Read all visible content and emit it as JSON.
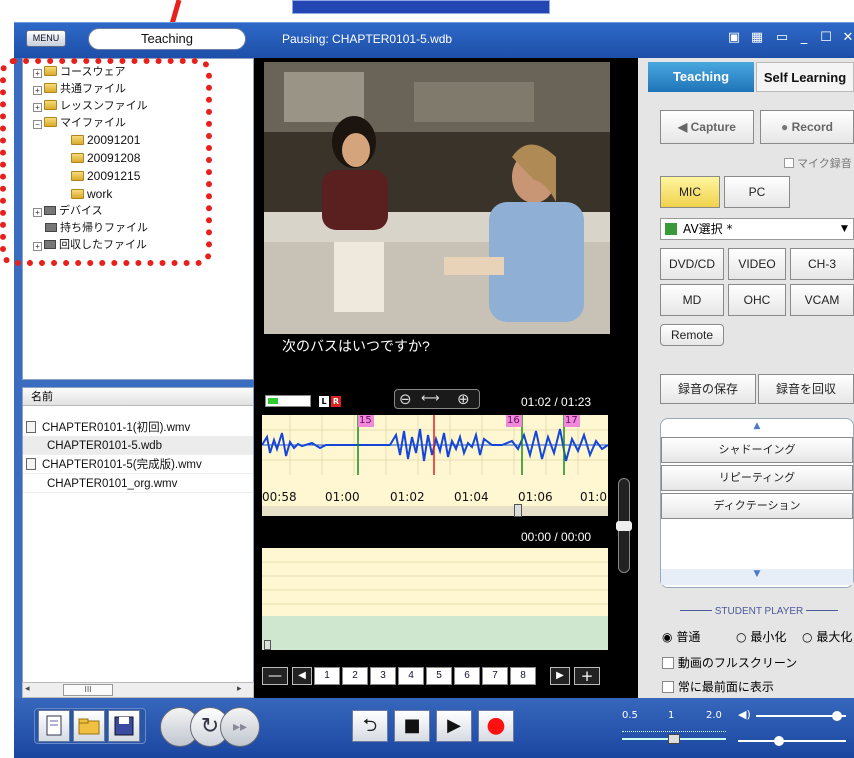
{
  "window": {
    "menu_label": "MENU",
    "mode_label": "Teaching",
    "title": "Pausing: CHAPTER0101-5.wdb"
  },
  "tree": {
    "items": [
      {
        "label": "コースウェア",
        "expander": "+"
      },
      {
        "label": "共通ファイル",
        "expander": "+"
      },
      {
        "label": "レッスンファイル",
        "expander": "+"
      },
      {
        "label": "マイファイル",
        "expander": "−"
      },
      {
        "label": "20091201"
      },
      {
        "label": "20091208"
      },
      {
        "label": "20091215"
      },
      {
        "label": "work"
      },
      {
        "label": "デバイス",
        "expander": "+"
      },
      {
        "label": "持ち帰りファイル"
      },
      {
        "label": "回収したファイル",
        "expander": "+"
      }
    ]
  },
  "filelist": {
    "header": "名前",
    "rows": [
      {
        "name": "CHAPTER0101-1(初回).wmv",
        "icon": "doc-icon"
      },
      {
        "name": "CHAPTER0101-5.wdb",
        "icon": ""
      },
      {
        "name": "CHAPTER0101-5(完成版).wmv",
        "icon": "doc-icon"
      },
      {
        "name": "CHAPTER0101_org.wmv",
        "icon": ""
      }
    ],
    "scroll_label": "III"
  },
  "player": {
    "subtitle": "次のバスはいつですか?",
    "time_main": "01:02 / 01:23",
    "time_rec": "00:00 / 00:00",
    "lr_l": "L",
    "lr_r": "R",
    "markers": [
      "15",
      "16",
      "17"
    ],
    "ticks": [
      "00:58",
      "01:00",
      "01:02",
      "01:04",
      "01:06",
      "01:0"
    ],
    "pages": [
      "1",
      "2",
      "3",
      "4",
      "5",
      "6",
      "7",
      "8"
    ]
  },
  "right": {
    "tab_teaching": "Teaching",
    "tab_self": "Self Learning",
    "capture": "Capture",
    "record": "Record",
    "mic_rec": "マイク録音",
    "mic": "MIC",
    "pc": "PC",
    "av_select": "AV選択 *",
    "sources_row1": [
      "DVD/CD",
      "VIDEO",
      "CH-3"
    ],
    "sources_row2": [
      "MD",
      "OHC",
      "VCAM"
    ],
    "remote": "Remote",
    "save_rec": "録音の保存",
    "collect_rec": "録音を回収",
    "modes": [
      "シャドーイング",
      "リピーティング",
      "ディクテーション"
    ],
    "student_player": "STUDENT PLAYER",
    "radio": [
      "普通",
      "最小化",
      "最大化"
    ],
    "checks": [
      "動画のフルスクリーン",
      "常に最前面に表示"
    ]
  },
  "bottom": {
    "speed_labels": [
      "0.5",
      "1",
      "2.0"
    ]
  },
  "colors": {
    "title_blue": "#1d4fa8",
    "annotation_red": "#e8201c",
    "record_red": "#ff1010",
    "tab_active": "#2e86c7"
  }
}
